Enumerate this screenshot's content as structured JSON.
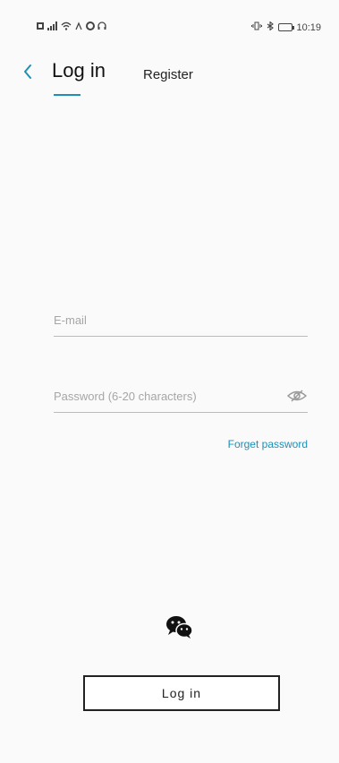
{
  "status_bar": {
    "time": "10:19",
    "left_icons": [
      "sim-icon",
      "signal-icon",
      "wifi-icon",
      "data-icon",
      "circle-icon",
      "headset-icon"
    ],
    "right_icons": [
      "vibrate-icon",
      "bluetooth-icon",
      "battery-icon"
    ]
  },
  "header": {
    "tabs": [
      {
        "label": "Log in",
        "active": true
      },
      {
        "label": "Register",
        "active": false
      }
    ]
  },
  "form": {
    "email_placeholder": "E-mail",
    "email_value": "",
    "password_placeholder": "Password (6-20 characters)",
    "password_value": "",
    "forget_label": "Forget password"
  },
  "actions": {
    "login_label": "Log in",
    "social_icon": "wechat-icon"
  },
  "colors": {
    "accent": "#1d8fb8",
    "text": "#222222",
    "placeholder": "#a6a6a6"
  }
}
